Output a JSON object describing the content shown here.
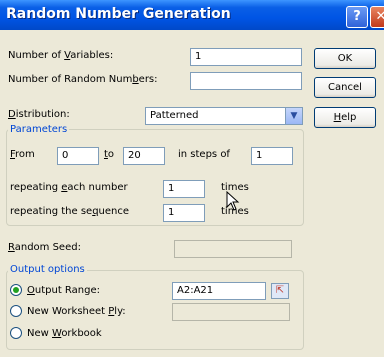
{
  "window": {
    "title": "Random Number Generation"
  },
  "titlebar_buttons": {
    "help": "?",
    "close": "✕"
  },
  "buttons": {
    "ok": "OK",
    "cancel": "Cancel",
    "help": "Help"
  },
  "labels": {
    "num_variables": "Number of Variables:",
    "num_random_numbers": "Number of Random Numbers:",
    "distribution": "Distribution:",
    "random_seed": "Random Seed:"
  },
  "fields": {
    "num_variables": "1",
    "num_random_numbers": "",
    "distribution": "Patterned",
    "random_seed": ""
  },
  "parameters": {
    "group_title": "Parameters",
    "from_label": "From",
    "from_value": "0",
    "to_label": "to",
    "to_value": "20",
    "steps_label": "in steps of",
    "steps_value": "1",
    "repeat_each_label": "repeating each number",
    "repeat_each_value": "1",
    "repeat_each_unit": "times",
    "repeat_seq_label": "repeating the sequence",
    "repeat_seq_value": "1",
    "repeat_seq_unit": "times"
  },
  "output": {
    "group_title": "Output options",
    "output_range_label": "Output Range:",
    "output_range_value": "A2:A21",
    "new_worksheet_label": "New Worksheet Ply:",
    "new_workbook_label": "New Workbook",
    "selected": "output_range"
  },
  "icons": {
    "combo_arrow": "chevron-down-icon",
    "ref": "range-select-icon"
  }
}
